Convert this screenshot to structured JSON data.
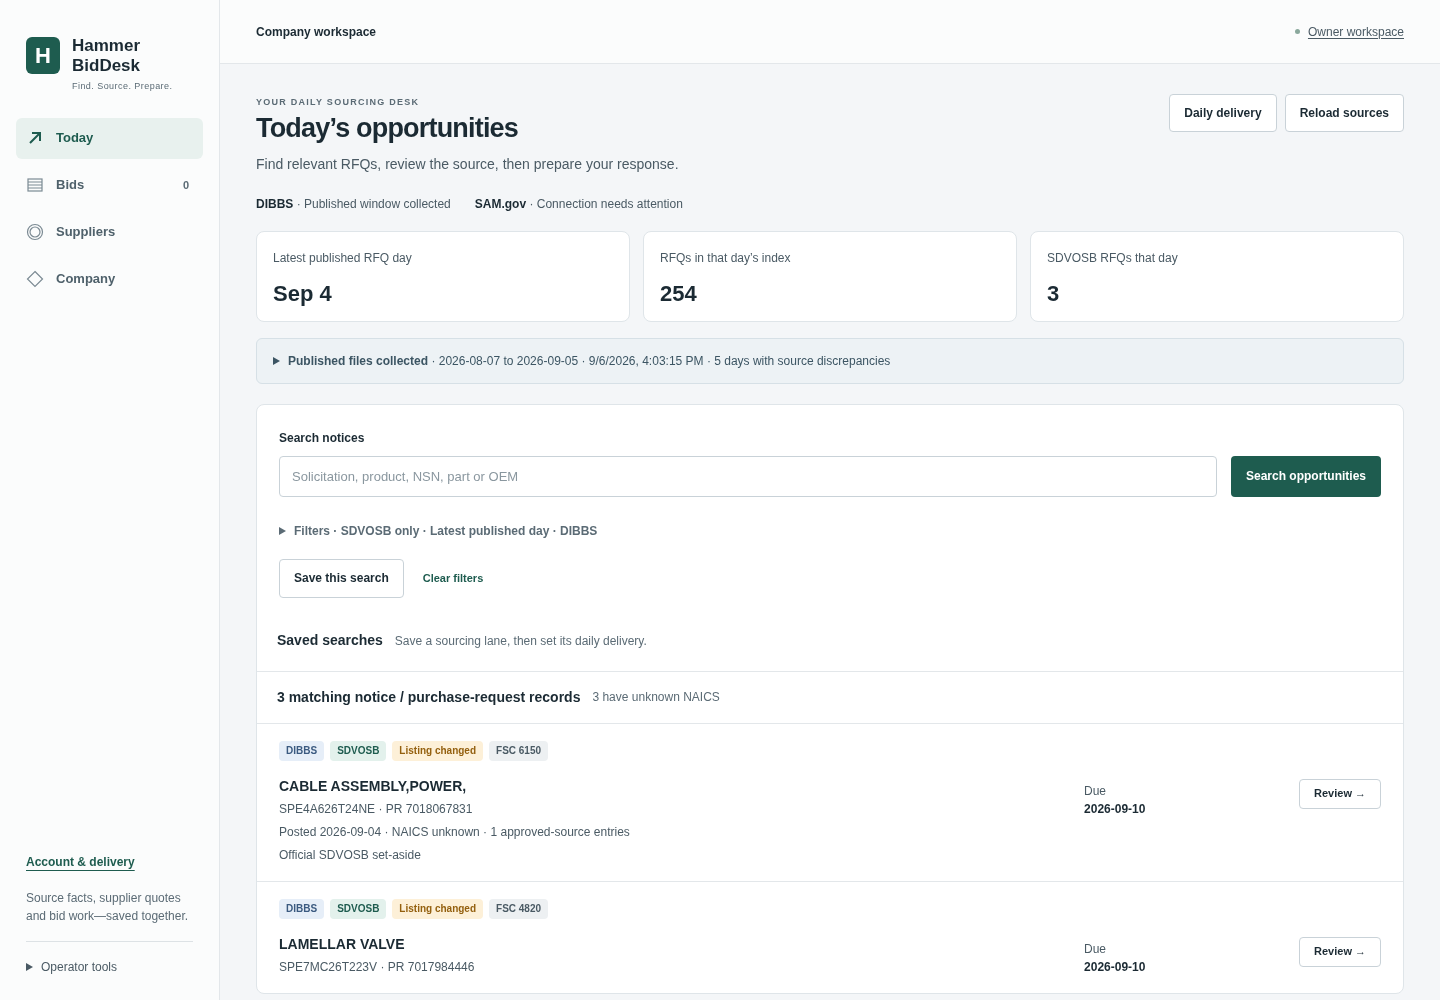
{
  "brand": {
    "logo_letter": "H",
    "name": "Hammer BidDesk",
    "tagline": "Find. Source. Prepare."
  },
  "sidebar": {
    "items": [
      {
        "label": "Today",
        "kind": "arrow",
        "selected": true
      },
      {
        "label": "Bids",
        "kind": "list",
        "selected": false,
        "count": "0"
      },
      {
        "label": "Suppliers",
        "kind": "circle",
        "selected": false
      },
      {
        "label": "Company",
        "kind": "diamond",
        "selected": false
      }
    ],
    "account_link": "Account & delivery",
    "blurb": "Source facts, supplier quotes and bid work—saved together.",
    "operator_tools": {
      "label": "Operator tools",
      "expanded": false
    }
  },
  "topbar": {
    "title": "Company workspace",
    "workspace_link": "Owner workspace"
  },
  "header": {
    "eyebrow": "YOUR DAILY SOURCING DESK",
    "title": "Today’s opportunities",
    "subtitle": "Find relevant RFQs, review the source, then prepare your response.",
    "buttons": [
      "Daily delivery",
      "Reload sources"
    ]
  },
  "sources": [
    {
      "name": "DIBBS",
      "status": "· Published window collected"
    },
    {
      "name": "SAM.gov",
      "status": "· Connection needs attention"
    }
  ],
  "stats": [
    {
      "label": "Latest published RFQ day",
      "value": "Sep 4"
    },
    {
      "label": "RFQs in that day’s index",
      "value": "254"
    },
    {
      "label": "SDVOSB RFQs that day",
      "value": "3"
    }
  ],
  "collection": {
    "title": "Published files collected",
    "detail": "· 2026-08-07 to 2026-09-05 · 9/6/2026, 4:03:15 PM · 5 days with source discrepancies",
    "expanded": false
  },
  "search": {
    "label": "Search notices",
    "placeholder": "Solicitation, product, NSN, part or OEM",
    "button": "Search opportunities",
    "filters": {
      "label": "Filters · SDVOSB only · Latest published day · DIBBS",
      "expanded": false
    },
    "save_button": "Save this search",
    "clear_link": "Clear filters"
  },
  "saved_searches": {
    "title": "Saved searches",
    "hint": "Save a sourcing lane, then set its daily delivery."
  },
  "results": {
    "title": "3 matching notice / purchase-request records",
    "note": "3 have unknown NAICS",
    "records": [
      {
        "tags": [
          {
            "label": "DIBBS",
            "kind": "source"
          },
          {
            "label": "SDVOSB",
            "kind": "setaside"
          },
          {
            "label": "Listing changed",
            "kind": "change"
          },
          {
            "label": "FSC 6150",
            "kind": "fsc"
          }
        ],
        "title": "CABLE ASSEMBLY,POWER,",
        "lines": [
          "SPE4A626T24NE · PR 7018067831",
          "Posted 2026-09-04 · NAICS unknown · 1 approved-source entries",
          "Official SDVOSB set-aside"
        ],
        "due_label": "Due",
        "due": "2026-09-10",
        "button": "Review →"
      },
      {
        "tags": [
          {
            "label": "DIBBS",
            "kind": "source"
          },
          {
            "label": "SDVOSB",
            "kind": "setaside"
          },
          {
            "label": "Listing changed",
            "kind": "change"
          },
          {
            "label": "FSC 4820",
            "kind": "fsc"
          }
        ],
        "title": "LAMELLAR VALVE",
        "lines": [
          "SPE7MC26T223V · PR 7017984446"
        ],
        "due_label": "Due",
        "due": "2026-09-10",
        "button": "Review →"
      }
    ]
  }
}
